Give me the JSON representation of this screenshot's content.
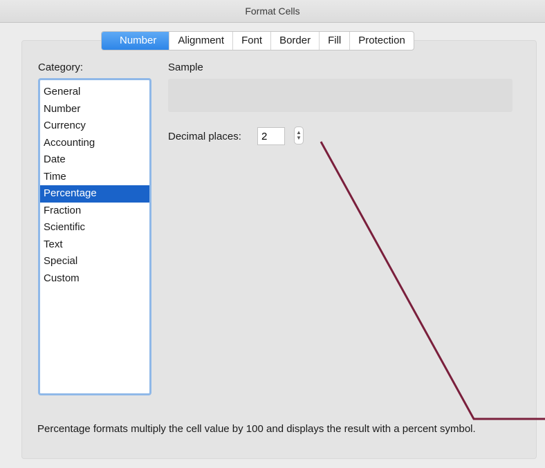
{
  "window": {
    "title": "Format Cells"
  },
  "tabs": [
    {
      "label": "Number",
      "active": true
    },
    {
      "label": "Alignment",
      "active": false
    },
    {
      "label": "Font",
      "active": false
    },
    {
      "label": "Border",
      "active": false
    },
    {
      "label": "Fill",
      "active": false
    },
    {
      "label": "Protection",
      "active": false
    }
  ],
  "category": {
    "label": "Category:",
    "items": [
      "General",
      "Number",
      "Currency",
      "Accounting",
      "Date",
      "Time",
      "Percentage",
      "Fraction",
      "Scientific",
      "Text",
      "Special",
      "Custom"
    ],
    "selected": "Percentage"
  },
  "sample": {
    "label": "Sample",
    "value": ""
  },
  "decimal_places": {
    "label": "Decimal places:",
    "value": "2"
  },
  "description": "Percentage formats multiply the cell value by 100 and displays the result with a percent symbol.",
  "colors": {
    "accent": "#2e86e8",
    "selection": "#1a63c9",
    "annotation_line": "#7a1f3c"
  }
}
